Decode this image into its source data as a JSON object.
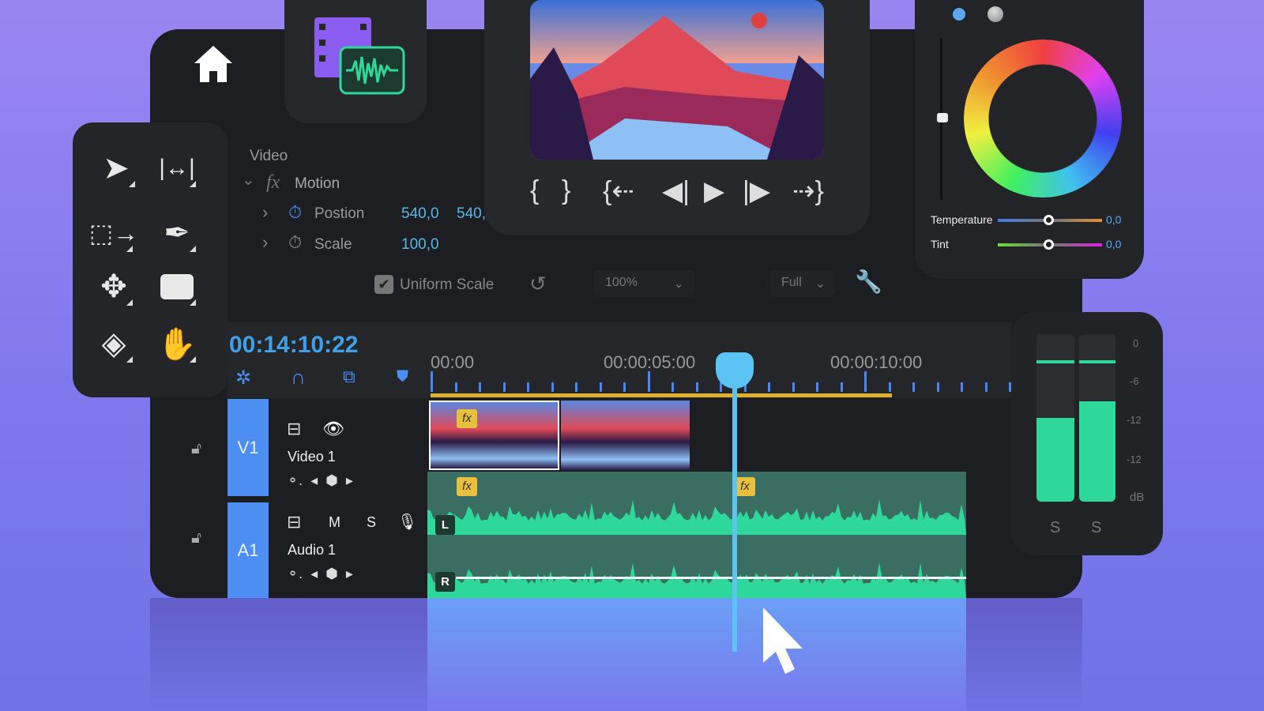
{
  "effects": {
    "section": "Video",
    "effect": "Motion",
    "position_label": "Postion",
    "position_x": "540,0",
    "position_y": "540,",
    "scale_label": "Scale",
    "scale_value": "100,0",
    "uniform_scale": "Uniform Scale",
    "uniform_checked": true,
    "zoom_select": "100%",
    "quality_select": "Full"
  },
  "playback": {
    "buttons": [
      "mark-in",
      "mark-out",
      "go-to-in",
      "step-back",
      "play",
      "step-forward",
      "go-to-out"
    ]
  },
  "color": {
    "temperature_label": "Temperature",
    "temperature_value": "0,0",
    "tint_label": "Tint",
    "tint_value": "0,0",
    "temperature_fraction": 0.5,
    "tint_fraction": 0.5
  },
  "timeline": {
    "timecode": "00:14:10:22",
    "ruler": [
      "00:00",
      "00:00:05:00",
      "00:00:10:00"
    ],
    "tracks": [
      {
        "id": "V1",
        "name": "Video 1"
      },
      {
        "id": "A1",
        "name": "Audio 1",
        "mute": "M",
        "solo": "S"
      }
    ],
    "channel_left": "L",
    "channel_right": "R",
    "fx": "fx"
  },
  "meter": {
    "scale": [
      "0",
      "-6",
      "-12",
      "-12",
      "dB"
    ],
    "solo": [
      "S",
      "S"
    ],
    "levels": [
      0.5,
      0.6
    ]
  },
  "colors": {
    "accent": "#4d8ef2",
    "timecode": "#3fa0e8",
    "audio": "#2ed89a",
    "playhead": "#5cc4f5",
    "work_area": "#e0b030"
  }
}
